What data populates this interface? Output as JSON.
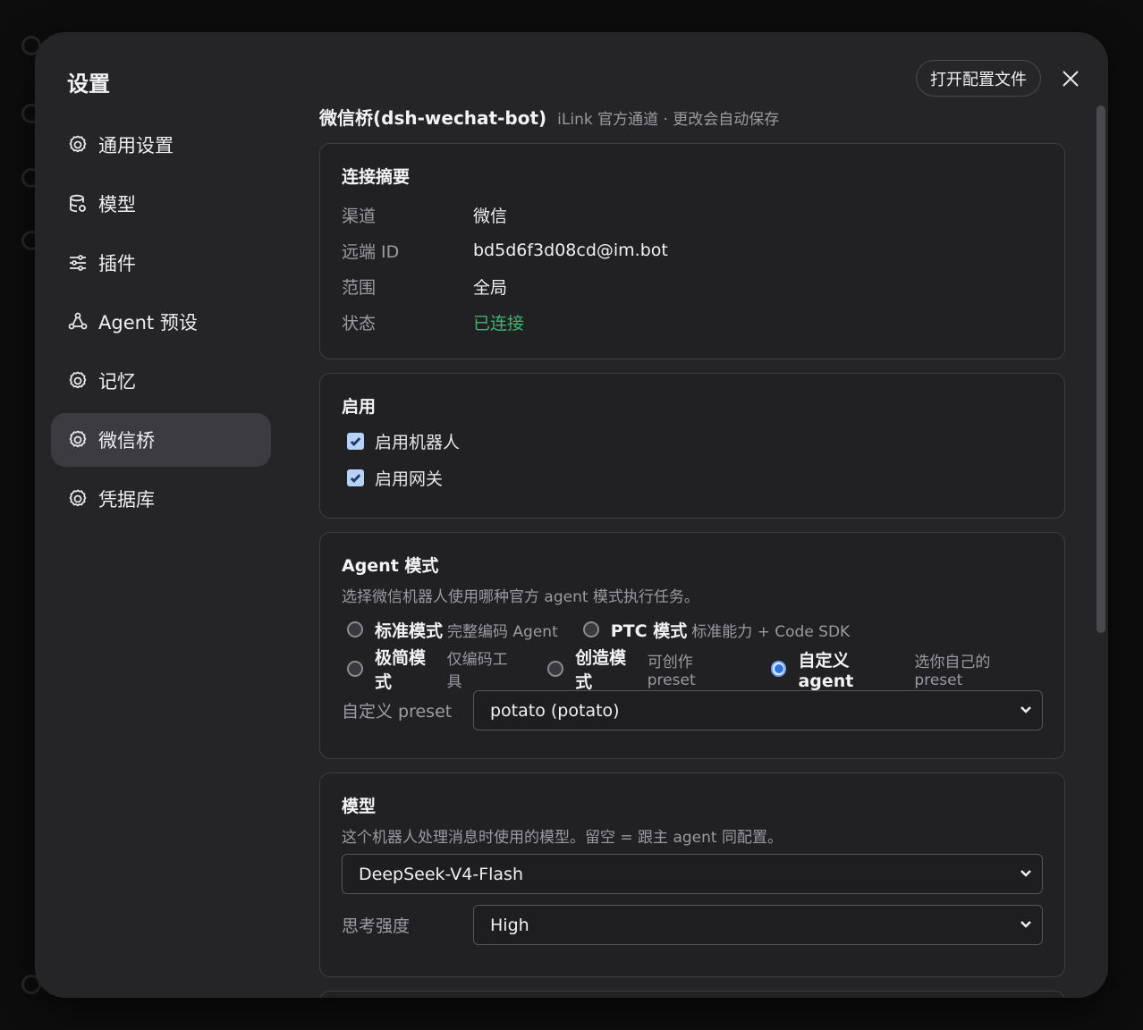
{
  "dialog": {
    "title": "设置",
    "open_config_label": "打开配置文件"
  },
  "sidebar": {
    "items": [
      {
        "label": "通用设置",
        "icon": "gear-icon"
      },
      {
        "label": "模型",
        "icon": "database-icon"
      },
      {
        "label": "插件",
        "icon": "sliders-icon"
      },
      {
        "label": "Agent 预设",
        "icon": "agent-icon"
      },
      {
        "label": "记忆",
        "icon": "gear-icon"
      },
      {
        "label": "微信桥",
        "icon": "gear-icon",
        "active": true
      },
      {
        "label": "凭据库",
        "icon": "gear-icon"
      }
    ]
  },
  "page": {
    "title": "微信桥(dsh-wechat-bot)",
    "subtitle": "iLink 官方通道 · 更改会自动保存"
  },
  "connection": {
    "title": "连接摘要",
    "rows": [
      {
        "key": "渠道",
        "value": "微信"
      },
      {
        "key": "远端 ID",
        "value": "bd5d6f3d08cd@im.bot"
      },
      {
        "key": "范围",
        "value": "全局"
      },
      {
        "key": "状态",
        "value": "已连接"
      }
    ],
    "status_color": "#3fb472"
  },
  "enable": {
    "title": "启用",
    "bot_label": "启用机器人",
    "bot_checked": true,
    "gateway_label": "启用网关",
    "gateway_checked": true
  },
  "agent_mode": {
    "title": "Agent 模式",
    "desc": "选择微信机器人使用哪种官方 agent 模式执行任务。",
    "options": [
      {
        "label": "标准模式",
        "desc": "完整编码 Agent",
        "selected": false
      },
      {
        "label": "PTC 模式",
        "desc": "标准能力 + Code SDK",
        "selected": false
      },
      {
        "label": "极简模式",
        "desc": "仅编码工具",
        "selected": false
      },
      {
        "label": "创造模式",
        "desc": "可创作 preset",
        "selected": false
      },
      {
        "label": "自定义 agent",
        "desc": "选你自己的 preset",
        "selected": true
      }
    ],
    "preset_label": "自定义 preset",
    "preset_value": "potato (potato)"
  },
  "model": {
    "title": "模型",
    "desc": "这个机器人处理消息时使用的模型。留空 = 跟主 agent 同配置。",
    "model_value": "DeepSeek-V4-Flash",
    "thinking_label": "思考强度",
    "thinking_value": "High"
  },
  "colors": {
    "accent": "#2f74de",
    "dialog_bg": "#252527"
  }
}
